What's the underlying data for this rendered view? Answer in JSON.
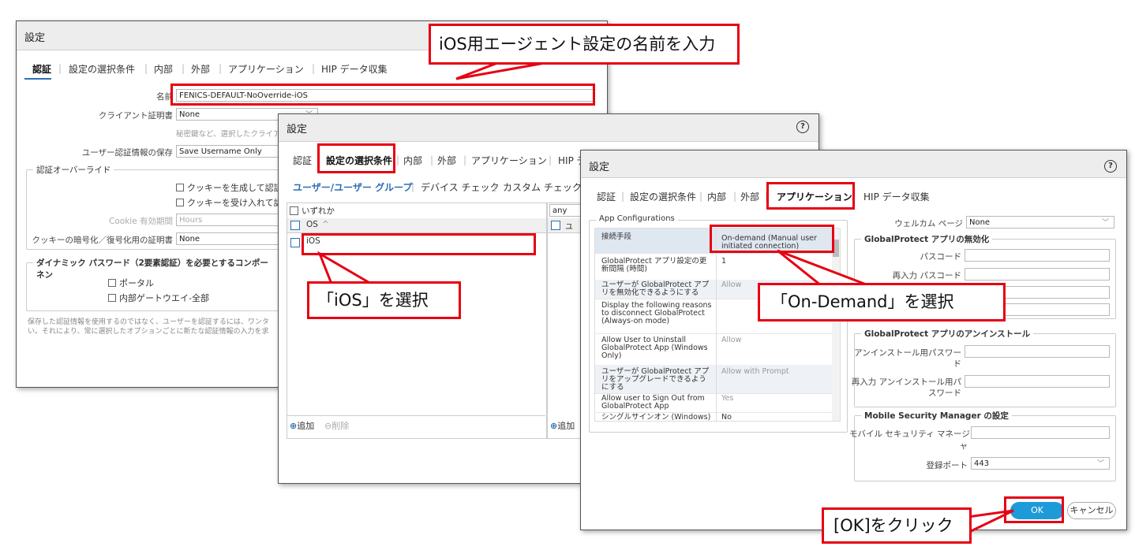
{
  "dialog1": {
    "title": "設定",
    "tabs": [
      "認証",
      "設定の選択条件",
      "内部",
      "外部",
      "アプリケーション",
      "HIP データ収集"
    ],
    "name_label": "名前",
    "name_value": "FENICS-DEFAULT-NoOverride-iOS",
    "client_cert_label": "クライアント証明書",
    "client_cert_value": "None",
    "hint": "秘密鍵など、選択したクライア",
    "save_cred_label": "ユーザー認証情報の保存",
    "save_cred_value": "Save Username Only",
    "auth_override_legend": "認証オーバーライド",
    "cookie_gen": "クッキーを生成して認証",
    "cookie_accept": "クッキーを受け入れて認",
    "cookie_lifetime_label": "Cookie 有効期間",
    "cookie_lifetime_value": "Hours",
    "cookie_cert_label": "クッキーの暗号化／復号化用の証明書",
    "cookie_cert_value": "None",
    "dynamic_legend": "ダイナミック パスワード（2要素認証）を必要とするコンポーネン",
    "portal": "ポータル",
    "internal_gw": "内部ゲートウエイ-全部",
    "footer_line1": "保存した認証情報を使用するのではなく、ユーザーを認証するには、ワンタ",
    "footer_line2": "い。それにより、常に選択したオプションごとに新たな認証情報の入力を求"
  },
  "dialog2": {
    "title": "設定",
    "tabs": [
      "認証",
      "設定の選択条件",
      "内部",
      "外部",
      "アプリケーション",
      "HIP デ"
    ],
    "subtabs": [
      "ユーザー/ユーザー グループ",
      "デバイス チェック",
      "カスタム チェック"
    ],
    "any_left": "いずれか",
    "os_header": "OS",
    "sort_icon": "^",
    "os_item": "iOS",
    "any_right_value": "any",
    "right_header": "ユ",
    "add_label": "追加",
    "delete_label": "削除",
    "add_label_right": "追加"
  },
  "dialog3": {
    "title": "設定",
    "tabs": [
      "認証",
      "設定の選択条件",
      "内部",
      "外部",
      "アプリケーション",
      "HIP データ収集"
    ],
    "app_config_legend": "App Configurations",
    "rows": [
      {
        "k": "接続手段",
        "v": "On-demand (Manual user initiated connection)"
      },
      {
        "k": "GlobalProtect アプリ設定の更新間隔 (時間)",
        "v": "1"
      },
      {
        "k": "ユーザーが GlobalProtect アプリを無効化できるようにする",
        "v": "Allow"
      },
      {
        "k": "Display the following reasons to disconnect GlobalProtect (Always-on mode)",
        "v": ""
      },
      {
        "k": "Allow User to Uninstall GlobalProtect App (Windows Only)",
        "v": "Allow"
      },
      {
        "k": "ユーザーが GlobalProtect アプリをアップグレードできるようにする",
        "v": "Allow with Prompt"
      },
      {
        "k": "Allow user to Sign Out from GlobalProtect App",
        "v": "Yes"
      },
      {
        "k": "シングルサインオン (Windows)の",
        "v": "No"
      }
    ],
    "welcome_label": "ウェルカム ページ",
    "welcome_value": "None",
    "disable_legend": "GlobalProtect アプリの無効化",
    "passcode_label": "パスコード",
    "repasscode_label": "再入力 パスコード",
    "uninstall_legend": "GlobalProtect アプリのアンインストール",
    "uninstall_pw_label_1": "アンインストール用パスワー",
    "uninstall_pw_label_2": "ド",
    "reuninstall_label_1": "再入力 アンインストール用パ",
    "reuninstall_label_2": "スワード",
    "msm_legend": "Mobile Security Manager の設定",
    "mobile_mgr_label_1": "モバイル セキュリティ マネージ",
    "mobile_mgr_label_2": "ャ",
    "reg_port_label": "登録ポート",
    "reg_port_value": "443",
    "ok_label": "OK",
    "cancel_label": "キャンセル"
  },
  "callouts": {
    "name": "iOS用エージェント設定の名前を入力",
    "ios": "「iOS」を選択",
    "ondemand": "「On-Demand」を選択",
    "ok": "[OK]をクリック"
  },
  "colors": {
    "annotation_red": "#e60012",
    "ok_blue": "#1d9bd8",
    "tab_blue": "#2e6fb3"
  }
}
